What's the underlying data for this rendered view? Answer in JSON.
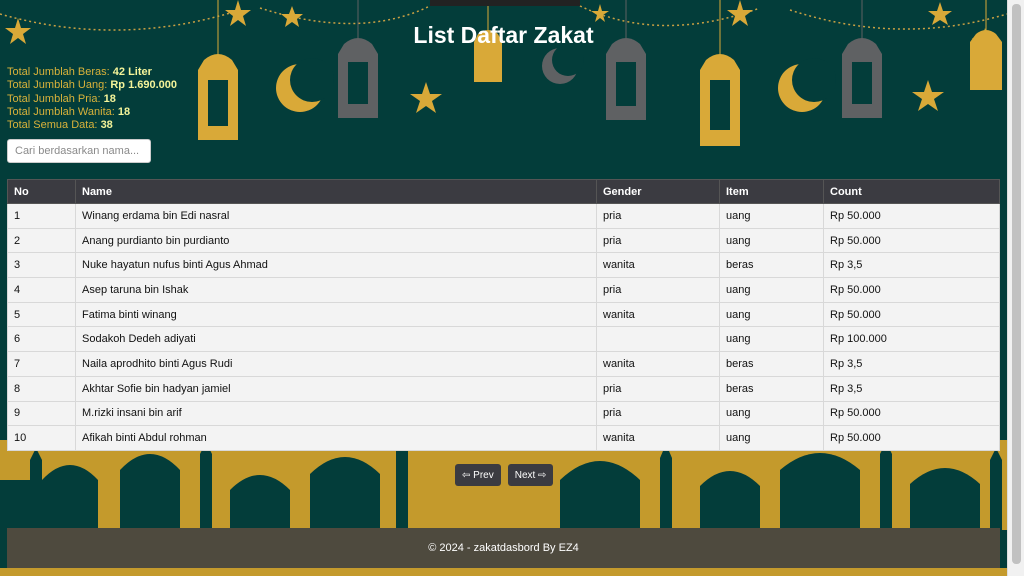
{
  "page": {
    "title": "List Daftar Zakat"
  },
  "stats": [
    {
      "label": "Total Jumblah Beras:",
      "value": "42 Liter"
    },
    {
      "label": "Total Jumblah Uang:",
      "value": "Rp 1.690.000"
    },
    {
      "label": "Total Jumblah Pria:",
      "value": "18"
    },
    {
      "label": "Total Jumblah Wanita:",
      "value": "18"
    },
    {
      "label": "Total Semua Data:",
      "value": "38"
    }
  ],
  "search": {
    "placeholder": "Cari berdasarkan nama...",
    "value": ""
  },
  "table": {
    "headers": [
      "No",
      "Name",
      "Gender",
      "Item",
      "Count"
    ],
    "rows": [
      [
        "1",
        "Winang erdama bin Edi nasral",
        "pria",
        "uang",
        "Rp 50.000"
      ],
      [
        "2",
        "Anang purdianto bin purdianto",
        "pria",
        "uang",
        "Rp 50.000"
      ],
      [
        "3",
        "Nuke hayatun nufus binti Agus Ahmad",
        "wanita",
        "beras",
        "Rp 3,5"
      ],
      [
        "4",
        "Asep taruna bin Ishak",
        "pria",
        "uang",
        "Rp 50.000"
      ],
      [
        "5",
        "Fatima binti winang",
        "wanita",
        "uang",
        "Rp 50.000"
      ],
      [
        "6",
        "Sodakoh Dedeh adiyati",
        "",
        "uang",
        "Rp 100.000"
      ],
      [
        "7",
        "Naila aprodhito binti Agus Rudi",
        "wanita",
        "beras",
        "Rp 3,5"
      ],
      [
        "8",
        "Akhtar Sofie bin hadyan jamiel",
        "pria",
        "beras",
        "Rp 3,5"
      ],
      [
        "9",
        "M.rizki insani bin arif",
        "pria",
        "uang",
        "Rp 50.000"
      ],
      [
        "10",
        "Afikah binti Abdul rohman",
        "wanita",
        "uang",
        "Rp 50.000"
      ]
    ]
  },
  "pagination": {
    "prev_label": "⇦ Prev",
    "next_label": "Next ⇨"
  },
  "footer": {
    "text": "© 2024 - zakatdasbord By EZ4"
  },
  "colors": {
    "background": "#033d3a",
    "gold": "#d9a938",
    "header": "#3b3b41"
  },
  "icons": [
    "lantern-icon",
    "crescent-moon-icon",
    "star-icon",
    "mosque-silhouette-icon"
  ]
}
